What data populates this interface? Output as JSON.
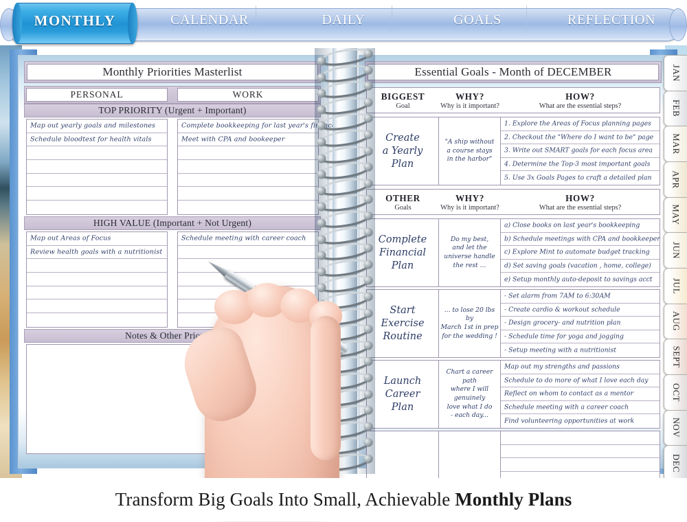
{
  "top_tabs": {
    "active": "MONTHLY",
    "items": [
      "MONTHLY",
      "CALENDAR",
      "DAILY",
      "GOALS",
      "REFLECTION"
    ]
  },
  "colors": {
    "active_tab": "#1f93d4",
    "tab_bar": "#9dbae4",
    "band": "#cdc4d5",
    "rule": "#b9b0c4",
    "ink": "#31406b"
  },
  "left_page": {
    "title": "Monthly Priorities Masterlist",
    "columns": [
      "PERSONAL",
      "WORK"
    ],
    "sections": [
      {
        "heading": "TOP PRIORITY (Urgent + Important)",
        "personal": [
          "Map out yearly goals and milestones",
          "Schedule bloodtest for health vitals",
          "",
          "",
          "",
          "",
          ""
        ],
        "work": [
          "Complete bookkeeping for last year's finances",
          "Meet with CPA and bookeeper",
          "",
          "",
          "",
          "",
          ""
        ]
      },
      {
        "heading": "HIGH VALUE (Important + Not Urgent)",
        "personal": [
          "Map out Areas of Focus",
          "Review health goals with a nutritionist",
          "",
          "",
          "",
          "",
          ""
        ],
        "work": [
          "Schedule meeting with career coach",
          "",
          "",
          "",
          "",
          "",
          ""
        ]
      }
    ],
    "notes_heading": "Notes & Other Priorities",
    "notes_value": ""
  },
  "right_page": {
    "title": "Essential Goals - Month of DECEMBER",
    "biggest_header": {
      "c1_line1": "BIGGEST",
      "c1_line2": "Goal",
      "c2_line1": "WHY?",
      "c2_line2": "Why is it important?",
      "c3_line1": "HOW?",
      "c3_line2": "What are the essential steps?"
    },
    "biggest_goal": {
      "goal": "Create\na Yearly\nPlan",
      "why": "\"A ship without\na course stays\nin the harbor\"",
      "steps": [
        "1. Explore the Areas of Focus planning pages",
        "2. Checkout the \"Where do I want to be\" page",
        "3. Write out SMART goals for each focus area",
        "4. Determine the Top-3 most important goals",
        "5. Use 3x Goals Pages to craft a detailed plan"
      ]
    },
    "other_header": {
      "c1_line1": "OTHER",
      "c1_line2": "Goals",
      "c2_line1": "WHY?",
      "c2_line2": "Why is it important?",
      "c3_line1": "HOW?",
      "c3_line2": "What are the essential steps?"
    },
    "other_goals": [
      {
        "goal": "Complete\nFinancial\nPlan",
        "why": "Do my best,\nand let the\nuniverse handle\nthe rest ...",
        "steps": [
          "a) Close books on last year's bookkeeping",
          "b) Schedule meetings with CPA and bookkeeper",
          "c) Explore Mint to automate budget tracking",
          "d) Set saving goals (vacation , home, college)",
          "e) Setup monthly auto-deposit to savings acct"
        ]
      },
      {
        "goal": "Start\nExercise\nRoutine",
        "why": "... to lose 20 lbs by\nMarch 1st in prep\nfor the wedding !",
        "steps": [
          "- Set alarm from 7AM to 6:30AM",
          "- Create cardio & workout schedule",
          "- Design grocery- and nutrition plan",
          "- Schedule time for yoga and jogging",
          "- Setup meeting with a nutritionist"
        ]
      },
      {
        "goal": "Launch\nCareer\nPlan",
        "why": "Chart a career path\nwhere I will genuinely\nlove what I do\n- each day...",
        "steps": [
          "Map out my strengths and passions",
          "Schedule to do more of what I love each day",
          "Reflect on whom to contact as a mentor",
          "Schedule meeting with a career coach",
          "Find volunteering opportunities at work"
        ]
      },
      {
        "goal": "",
        "why": "",
        "steps": [
          "",
          "",
          "",
          "",
          ""
        ]
      }
    ]
  },
  "month_tabs": [
    {
      "label": "JAN",
      "color": "#e9eaec"
    },
    {
      "label": "FEB",
      "color": "#dfe0e4"
    },
    {
      "label": "MAR",
      "color": "#f3eee0"
    },
    {
      "label": "APR",
      "color": "#efe6cf"
    },
    {
      "label": "MAY",
      "color": "#f2e9d2"
    },
    {
      "label": "JUN",
      "color": "#f5eddb"
    },
    {
      "label": "JUL",
      "color": "#f6e9cf"
    },
    {
      "label": "AUG",
      "color": "#f2ded0"
    },
    {
      "label": "SEPT",
      "color": "#ead7cf"
    },
    {
      "label": "OCT",
      "color": "#e3dcdb"
    },
    {
      "label": "NOV",
      "color": "#dededf"
    },
    {
      "label": "DEC",
      "color": "#d9dade"
    }
  ],
  "caption": {
    "normal": "Transform Big Goals Into Small, Achievable ",
    "bold": "Monthly Plans"
  }
}
